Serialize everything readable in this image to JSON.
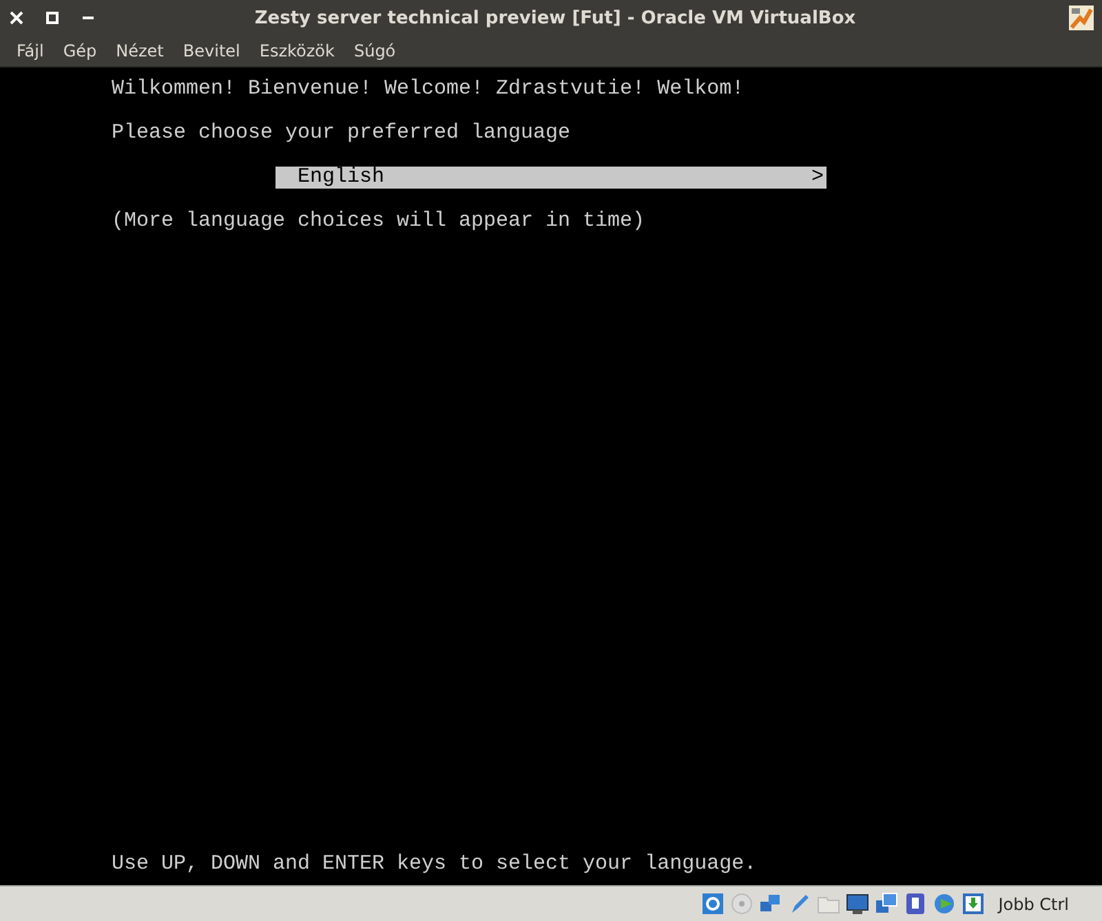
{
  "window": {
    "title": "Zesty server technical preview [Fut] - Oracle VM VirtualBox"
  },
  "menu": [
    "Fájl",
    "Gép",
    "Nézet",
    "Bevitel",
    "Eszközök",
    "Súgó"
  ],
  "console": {
    "greeting": "Wilkommen! Bienvenue! Welcome! Zdrastvutie! Welkom!",
    "prompt": "Please choose your preferred language",
    "options": [
      {
        "label": "English",
        "arrow": ">",
        "selected": true
      }
    ],
    "note": "(More language choices will appear in time)",
    "help": "Use UP, DOWN and ENTER keys to select your language."
  },
  "status_bar": {
    "host_key": "Jobb Ctrl"
  }
}
